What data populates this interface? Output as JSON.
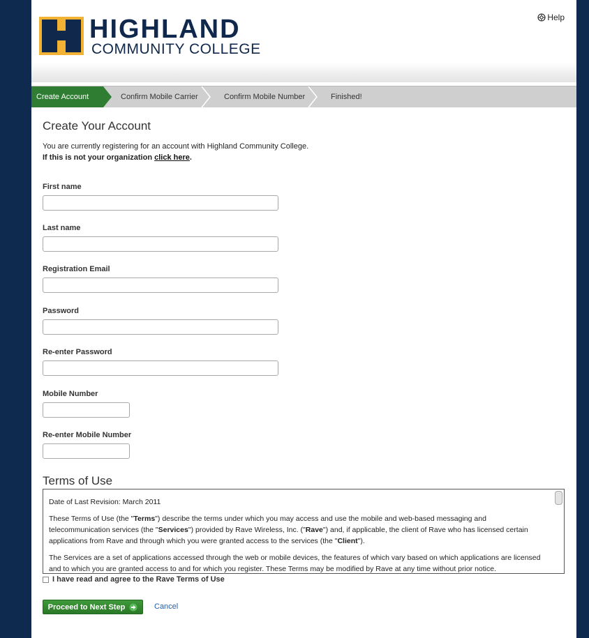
{
  "header": {
    "logo_word": "HIGHLAND",
    "logo_sub": "COMMUNITY COLLEGE",
    "help_label": "Help"
  },
  "steps": [
    {
      "label": "Create Account"
    },
    {
      "label": "Confirm Mobile Carrier"
    },
    {
      "label": "Confirm Mobile Number"
    },
    {
      "label": "Finished!"
    }
  ],
  "form": {
    "title": "Create Your Account",
    "intro": "You are currently registering for an account with Highland Community College.",
    "org_prompt": "If this is not your organization",
    "org_link": "click here",
    "org_suffix": ".",
    "fields": [
      {
        "label": "First name",
        "value": ""
      },
      {
        "label": "Last name",
        "value": ""
      },
      {
        "label": "Registration Email",
        "value": ""
      },
      {
        "label": "Password",
        "value": ""
      },
      {
        "label": "Re-enter Password",
        "value": ""
      },
      {
        "label": "Mobile Number",
        "value": ""
      },
      {
        "label": "Re-enter Mobile Number",
        "value": ""
      }
    ]
  },
  "terms": {
    "title": "Terms of Use",
    "revision": "Date of Last Revision: March 2011",
    "p1_a": "These Terms of Use (the \"",
    "p1_terms": "Terms",
    "p1_b": "\") describe the terms under which you may access and use the mobile and web-based messaging and telecommunication services (the \"",
    "p1_services": "Services",
    "p1_c": "\") provided by Rave Wireless, Inc. (\"",
    "p1_rave": "Rave",
    "p1_d": "\") and, if applicable, the client of Rave who has licensed certain applications from Rave and through which you were granted access to the services (the \"",
    "p1_client": "Client",
    "p1_e": "\").",
    "p2": "The Services are a set of applications accessed through the web or mobile devices, the features of which vary based on which applications are licensed and to which you are granted access to and for which you register. These Terms may be modified by Rave at any time without prior notice.",
    "agree_label": "I have read and agree to the Rave Terms of Use"
  },
  "actions": {
    "proceed_label": "Proceed to Next Step",
    "cancel_label": "Cancel"
  },
  "colors": {
    "navy": "#0f2a4f",
    "step_active": "#2f7d32",
    "link": "#1f5fa8"
  }
}
